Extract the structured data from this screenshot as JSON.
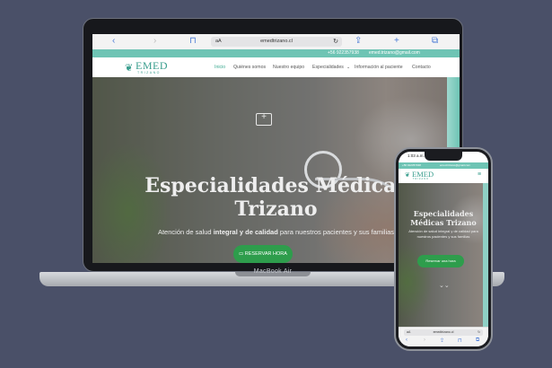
{
  "laptop": {
    "brand": "MacBook Air",
    "browser": {
      "aa": "aA",
      "url": "emedtrizano.cl",
      "icons": [
        "back-icon",
        "forward-icon",
        "book-icon",
        "share-icon",
        "new-tab-icon",
        "tabs-icon"
      ]
    },
    "topbar": {
      "phone": "+56 922357938",
      "email": "emed.trizano@gmail.com"
    },
    "logo": {
      "word": "EMED",
      "sub": "TRIZANO"
    },
    "nav": [
      "Inicio",
      "Quiénes somos",
      "Nuestro equipo",
      "Especialidades",
      "Información al paciente",
      "Contacto"
    ],
    "hero": {
      "title_line1": "Especialidades Médicas",
      "title_line2": "Trizano",
      "subtitle_pre": "Atención de salud ",
      "subtitle_bold": "integral y de calidad",
      "subtitle_post": " para nuestros pacientes y sus familias",
      "button": "RESERVAR HORA"
    }
  },
  "phone": {
    "time": "1:03 a.m.",
    "topbar": {
      "phone": "+56 922357938",
      "email": "emed.trizano@gmail.com"
    },
    "logo": {
      "word": "EMED",
      "sub": "TRIZANO"
    },
    "hero": {
      "title_line1": "Especialidades",
      "title_line2": "Médicas Trizano",
      "subtitle": "Atención de salud integral y de calidad para nuestros pacientes y sus familias",
      "button": "Reservar una hora"
    },
    "browser": {
      "aa": "aA",
      "url": "emedtrizano.cl"
    }
  },
  "colors": {
    "teal": "#6ec4b4",
    "green_button": "#2e9d4c",
    "background": "#4a5068"
  }
}
